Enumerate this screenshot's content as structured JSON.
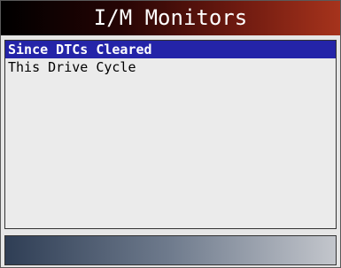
{
  "header": {
    "title": "I/M Monitors"
  },
  "menu": {
    "items": [
      {
        "label": "Since DTCs Cleared",
        "selected": true
      },
      {
        "label": "This Drive Cycle",
        "selected": false
      }
    ]
  },
  "colors": {
    "title_gradient_start": "#000000",
    "title_gradient_end": "#a6331c",
    "selection": "#2424a8",
    "background": "#e6e6e6",
    "footer_gradient_start": "#2f3e55",
    "footer_gradient_end": "#c3c6cc"
  }
}
